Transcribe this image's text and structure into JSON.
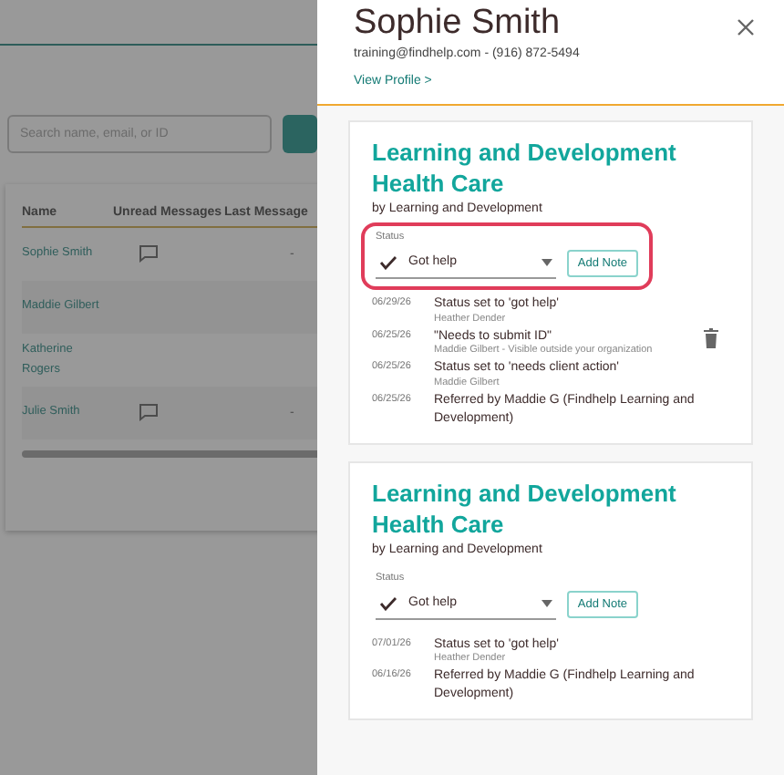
{
  "background_page": {
    "search": {
      "placeholder": "Search name, email, or ID"
    },
    "table": {
      "columns": [
        "Name",
        "Unread Messages",
        "Last Message"
      ],
      "rows": [
        {
          "name": "Sophie Smith",
          "unread": true,
          "last": "-"
        },
        {
          "name": "Maddie Gilbert",
          "unread": false,
          "last": ""
        },
        {
          "name": "Katherine Rogers",
          "unread": false,
          "last": ""
        },
        {
          "name": "Julie Smith",
          "unread": true,
          "last": "-"
        }
      ]
    }
  },
  "panel": {
    "name": "Sophie Smith",
    "contact": "training@findhelp.com - (916) 872-5494",
    "profile_link": "View Profile >",
    "referrals": [
      {
        "title": "Learning and Development Health Care",
        "provider": "by Learning and Development",
        "status_label": "Status",
        "status": "Got help",
        "highlighted": true,
        "add_note": "Add Note",
        "notes": [
          {
            "date": "06/29/26",
            "text": "Status set to 'got help'",
            "author": "Heather Dender",
            "deletable": false
          },
          {
            "date": "06/25/26",
            "text": "\"Needs to submit ID\"",
            "author": "Maddie Gilbert - Visible outside your organization",
            "deletable": true
          },
          {
            "date": "06/25/26",
            "text": "Status set to 'needs client action'",
            "author": "Maddie Gilbert",
            "deletable": false
          },
          {
            "date": "06/25/26",
            "text": "Referred by Maddie G (Findhelp Learning and Development)",
            "deletable": false
          }
        ]
      },
      {
        "title": "Learning and Development Health Care",
        "provider": "by Learning and Development",
        "status_label": "Status",
        "status": "Got help",
        "highlighted": false,
        "add_note": "Add Note",
        "notes": [
          {
            "date": "07/01/26",
            "text": "Status set to 'got help'",
            "author": "Heather Dender",
            "deletable": false
          },
          {
            "date": "06/16/26",
            "text": "Referred by Maddie G (Findhelp Learning and Development)",
            "deletable": false
          }
        ]
      }
    ]
  }
}
